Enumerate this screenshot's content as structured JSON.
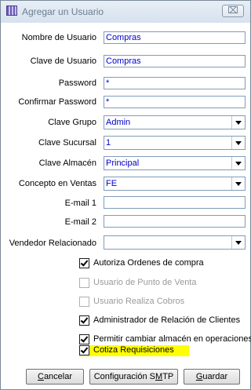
{
  "window": {
    "title": "Agregar un Usuario",
    "close_glyph": "⌧",
    "icon": "app-window-icon"
  },
  "fields": [
    {
      "label": "Nombre de Usuario",
      "value": "Compras"
    },
    {
      "label": "Clave de Usuario",
      "value": "Compras"
    },
    {
      "label": "Password",
      "value": "*"
    },
    {
      "label": "Confirmar Password",
      "value": "*"
    }
  ],
  "combos": [
    {
      "label": "Clave Grupo",
      "value": "Admin"
    },
    {
      "label": "Clave Sucursal",
      "value": "1"
    },
    {
      "label": "Clave Almacén",
      "value": "Principal"
    },
    {
      "label": "Concepto en Ventas",
      "value": "FE"
    }
  ],
  "emails": [
    {
      "label": "E-mail 1",
      "value": ""
    },
    {
      "label": "E-mail 2",
      "value": ""
    }
  ],
  "vendedor": {
    "label": "Vendedor Relacionado",
    "value": ""
  },
  "checkboxes": [
    {
      "label": "Autoriza Ordenes de compra",
      "checked": true,
      "enabled": true
    },
    {
      "label": "Usuario de Punto de Venta",
      "checked": false,
      "enabled": false
    },
    {
      "label": "Usuario Realiza Cobros",
      "checked": false,
      "enabled": false
    },
    {
      "label": "Administrador de Relación de Clientes",
      "checked": true,
      "enabled": true
    },
    {
      "label": "Permitir cambiar almacén en operaciones",
      "checked": true,
      "enabled": true
    },
    {
      "label": "Cotiza Requisiciones",
      "checked": true,
      "enabled": true,
      "highlighted": true
    }
  ],
  "buttons": {
    "cancel": {
      "pre": "",
      "key": "C",
      "post": "ancelar"
    },
    "config": {
      "pre": "Configuración S",
      "key": "M",
      "post": "TP"
    },
    "save": {
      "pre": "",
      "key": "G",
      "post": "uardar"
    }
  },
  "colors": {
    "value_text": "#0000cc",
    "highlight": "#ffff00",
    "disabled_text": "#9a9a9a"
  }
}
